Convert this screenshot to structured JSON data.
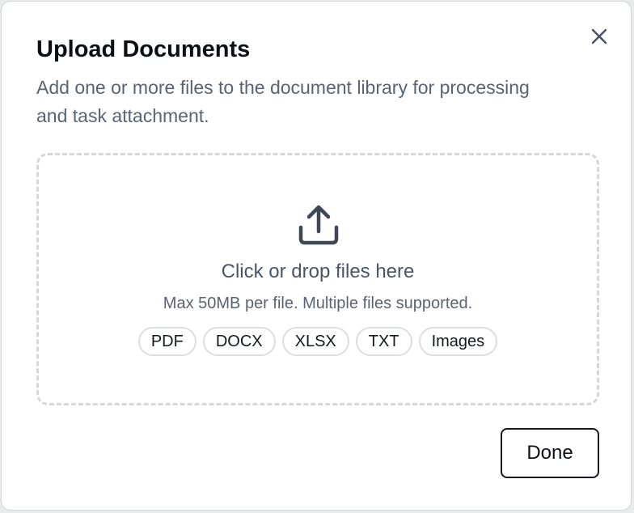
{
  "dialog": {
    "title": "Upload Documents",
    "description": "Add one or more files to the document library for processing and task attachment.",
    "close_icon": "close-icon"
  },
  "dropzone": {
    "icon": "upload-icon",
    "title": "Click or drop files here",
    "hint": "Max 50MB per file. Multiple files supported.",
    "file_types": [
      "PDF",
      "DOCX",
      "XLSX",
      "TXT",
      "Images"
    ]
  },
  "footer": {
    "done_label": "Done"
  }
}
